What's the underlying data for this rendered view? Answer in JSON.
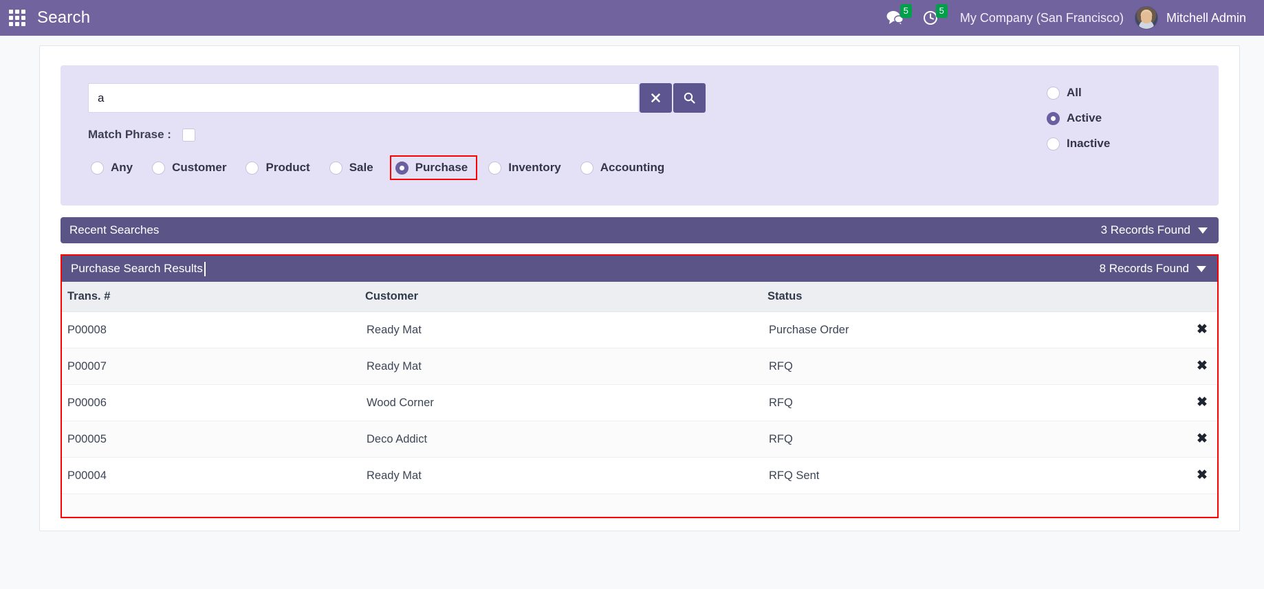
{
  "navbar": {
    "apps_icon": "apps-grid-icon",
    "brand": "Search",
    "messages": {
      "icon": "chat-icon",
      "count": "5"
    },
    "activities": {
      "icon": "clock-icon",
      "count": "5"
    },
    "company": "My Company (San Francisco)",
    "user": "Mitchell Admin",
    "background_color": "#71639e",
    "badge_color": "#00a04a"
  },
  "search_panel": {
    "background_color": "#e4e1f7",
    "query_value": "a",
    "query_placeholder": "",
    "clear_button_label": "✖",
    "search_button_icon": "magnifier-icon",
    "match_phrase_label": "Match Phrase :",
    "match_phrase_checked": false,
    "type_options": [
      {
        "label": "Any",
        "checked": false,
        "highlighted": false
      },
      {
        "label": "Customer",
        "checked": false,
        "highlighted": false
      },
      {
        "label": "Product",
        "checked": false,
        "highlighted": false
      },
      {
        "label": "Sale",
        "checked": false,
        "highlighted": false
      },
      {
        "label": "Purchase",
        "checked": true,
        "highlighted": true
      },
      {
        "label": "Inventory",
        "checked": false,
        "highlighted": false
      },
      {
        "label": "Accounting",
        "checked": false,
        "highlighted": false
      }
    ],
    "state_options": [
      {
        "label": "All",
        "checked": false
      },
      {
        "label": "Active",
        "checked": true
      },
      {
        "label": "Inactive",
        "checked": false
      }
    ],
    "highlight_color": "#ff0000",
    "accent_color": "#6a5fa0"
  },
  "recent_searches": {
    "title": "Recent Searches",
    "records_found": "3 Records Found",
    "header_color": "#5b5587"
  },
  "results": {
    "title": "Purchase Search Results",
    "records_found": "8 Records Found",
    "header_color": "#5b5587",
    "outline_color": "#ff0000",
    "columns": [
      "Trans. #",
      "Customer",
      "Status",
      ""
    ],
    "rows": [
      {
        "trans": "P00008",
        "customer": "Ready Mat",
        "status": "Purchase Order",
        "delete": "✖"
      },
      {
        "trans": "P00007",
        "customer": "Ready Mat",
        "status": "RFQ",
        "delete": "✖"
      },
      {
        "trans": "P00006",
        "customer": "Wood Corner",
        "status": "RFQ",
        "delete": "✖"
      },
      {
        "trans": "P00005",
        "customer": "Deco Addict",
        "status": "RFQ",
        "delete": "✖"
      },
      {
        "trans": "P00004",
        "customer": "Ready Mat",
        "status": "RFQ Sent",
        "delete": "✖"
      }
    ]
  }
}
